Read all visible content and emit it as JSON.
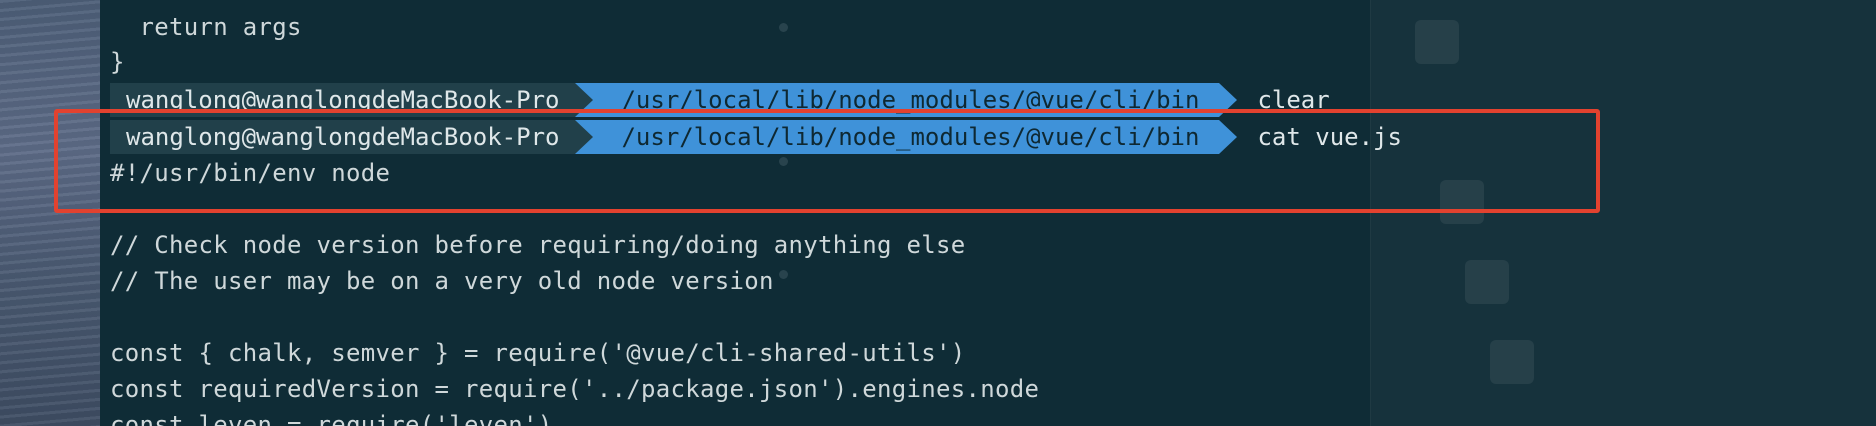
{
  "terminal": {
    "lines_top": [
      {
        "id": "return",
        "text": "  return args"
      },
      {
        "id": "close-brace",
        "text": "}"
      }
    ],
    "prompts": [
      {
        "user_host": "wanglong@wanglongdeMacBook-Pro",
        "path": "/usr/local/lib/node_modules/@vue/cli/bin",
        "command": "clear"
      },
      {
        "user_host": "wanglong@wanglongdeMacBook-Pro",
        "path": "/usr/local/lib/node_modules/@vue/cli/bin",
        "command": "cat vue.js"
      }
    ],
    "output_lines": [
      "#!/usr/bin/env node",
      "",
      "// Check node version before requiring/doing anything else",
      "// The user may be on a very old node version",
      "",
      "const { chalk, semver } = require('@vue/cli-shared-utils')",
      "const requiredVersion = require('../package.json').engines.node",
      "const leven = require('leven')"
    ]
  },
  "colors": {
    "terminal_bg": "#0f2c36",
    "user_segment": "#21404a",
    "path_segment": "#3f92d9",
    "highlight": "#e2422f"
  }
}
